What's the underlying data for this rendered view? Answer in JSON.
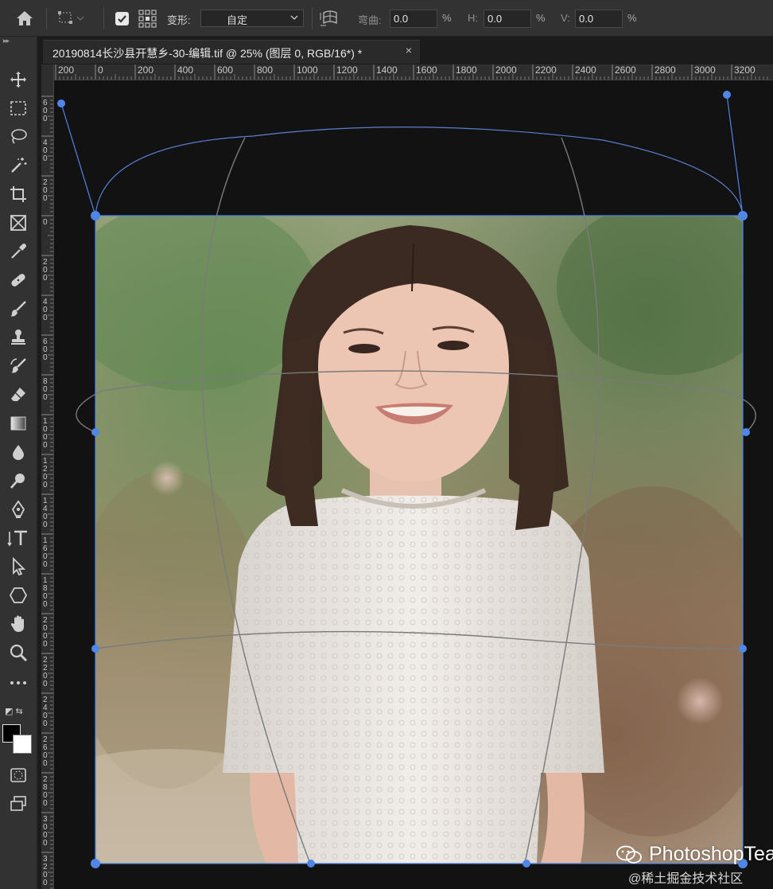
{
  "options_bar": {
    "transform_label": "变形:",
    "transform_value": "自定",
    "warp_label": "弯曲:",
    "warp_value": "0.0",
    "warp_unit": "%",
    "h_label": "H:",
    "h_value": "0.0",
    "h_unit": "%",
    "v_label": "V:",
    "v_value": "0.0",
    "v_unit": "%"
  },
  "document_tab": {
    "title": "20190814长沙县开慧乡-30-编辑.tif @ 25% (图层 0, RGB/16*) *",
    "close": "×"
  },
  "toolbar": {
    "icons": [
      "move-icon",
      "marquee-icon",
      "lasso-icon",
      "magic-wand-icon",
      "crop-icon",
      "frame-icon",
      "eyedropper-icon",
      "healing-brush-icon",
      "brush-icon",
      "clone-stamp-icon",
      "history-brush-icon",
      "eraser-icon",
      "gradient-icon",
      "blur-icon",
      "dodge-icon",
      "pen-icon",
      "type-icon",
      "path-select-icon",
      "shape-icon",
      "hand-icon",
      "zoom-icon",
      "more-tools-icon"
    ],
    "foreground_color": "#000000",
    "background_color": "#ffffff"
  },
  "ruler_top": {
    "labels": [
      "200",
      "0",
      "200",
      "400",
      "600",
      "800",
      "1000",
      "1200",
      "1400",
      "1600",
      "1800",
      "2000",
      "2200",
      "2400",
      "2600",
      "2800",
      "3000",
      "3200"
    ]
  },
  "ruler_left": {
    "labels": [
      "600",
      "400",
      "200",
      "0",
      "200",
      "400",
      "600",
      "800",
      "1000",
      "1200",
      "1400",
      "1600",
      "1800",
      "2000",
      "2200",
      "2400",
      "2600",
      "2800",
      "3000",
      "3200"
    ]
  },
  "watermark": {
    "brand": "PhotoshopTea",
    "site": "@稀土掘金技术社区"
  },
  "colors": {
    "accent_handle": "#4f86e8",
    "warp_line": "#8a8a8a"
  }
}
